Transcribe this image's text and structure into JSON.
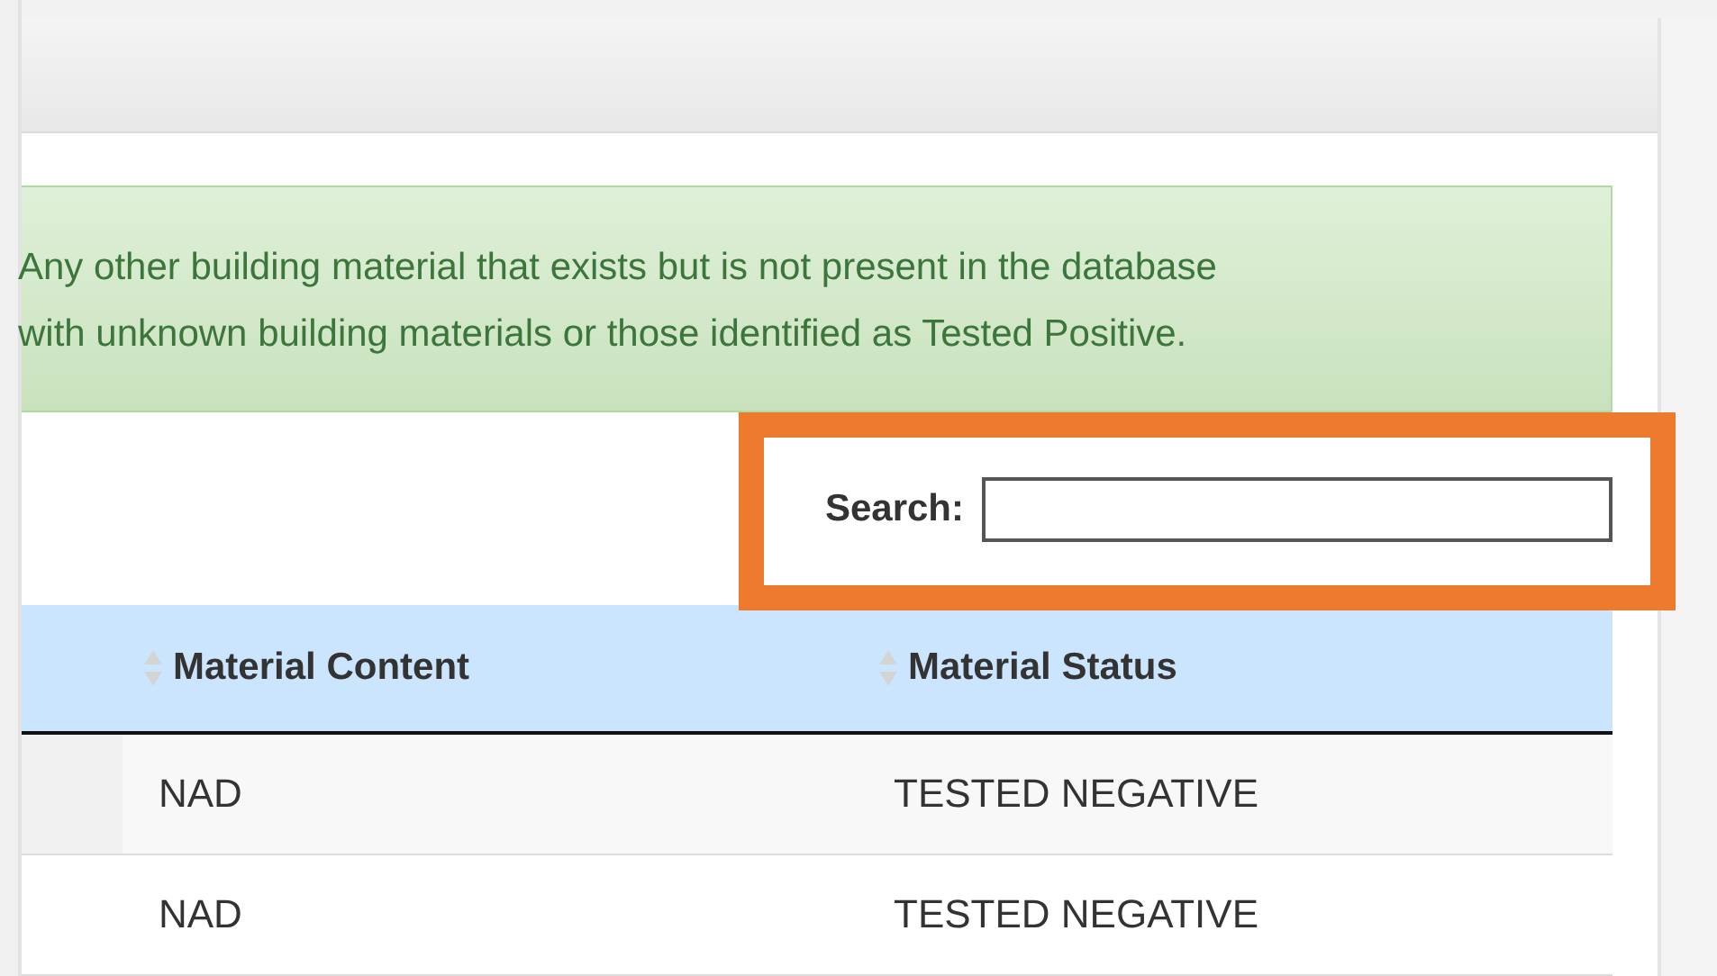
{
  "alert": {
    "lines": [
      "Any other building material that exists but is not present in the database",
      "with unknown building materials or those identified as Tested Positive."
    ]
  },
  "search": {
    "label": "Search:",
    "highlighted": true
  },
  "table": {
    "columns": [
      {
        "label": "Material Content",
        "sortable": true
      },
      {
        "label": "Material Status",
        "sortable": true
      }
    ],
    "rows": [
      {
        "cells": [
          "NAD",
          "TESTED NEGATIVE"
        ]
      },
      {
        "cells": [
          "NAD",
          "TESTED NEGATIVE"
        ]
      }
    ]
  }
}
